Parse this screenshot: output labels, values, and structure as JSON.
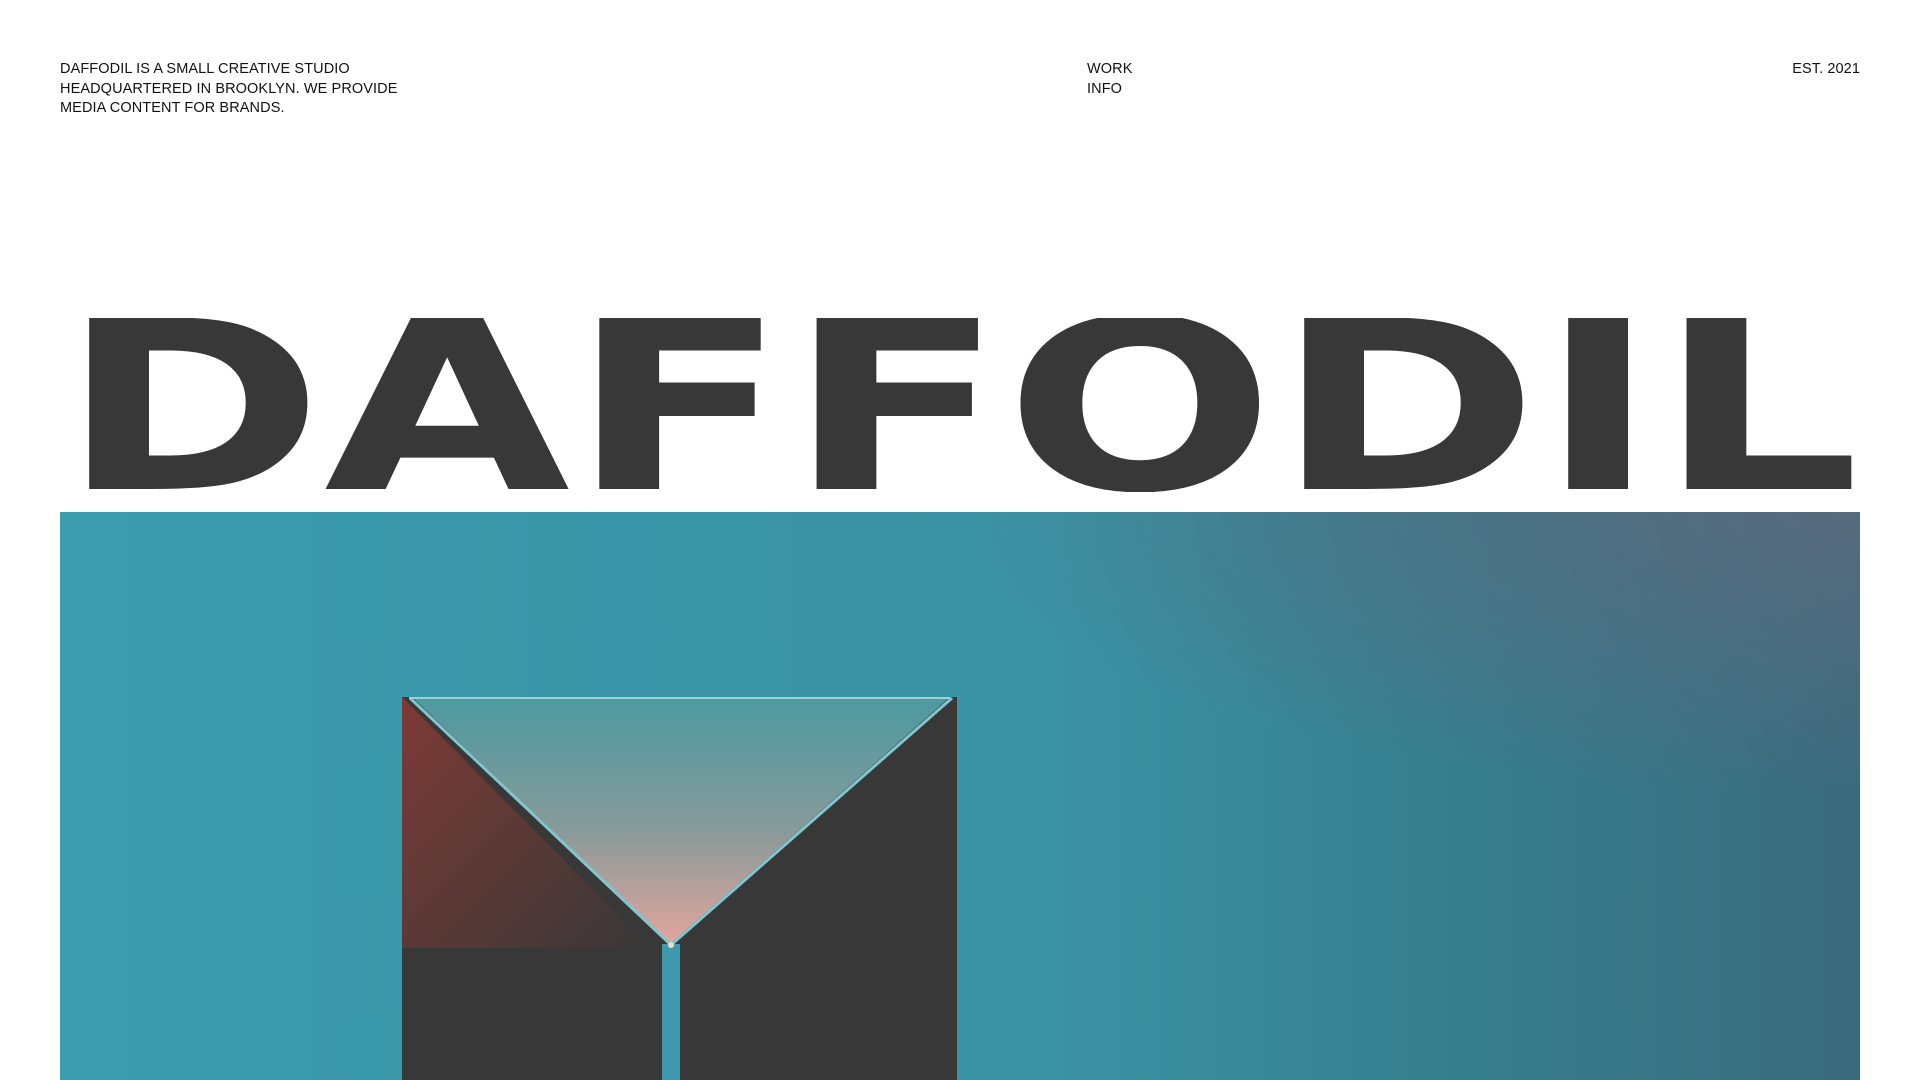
{
  "header": {
    "tagline_lines": [
      "DAFFODIL IS A SMALL CREATIVE STUDIO",
      "HEADQUARTERED IN BROOKLYN. WE PROVIDE",
      "MEDIA CONTENT FOR BRANDS."
    ],
    "nav": {
      "work_label": "WORK",
      "info_label": "INFO"
    },
    "established": "EST. 2021"
  },
  "hero": {
    "wordmark": "DAFFODIL",
    "wordmark_color": "#383838",
    "image_background": "#3a9aad",
    "prism_color": "#383838"
  }
}
